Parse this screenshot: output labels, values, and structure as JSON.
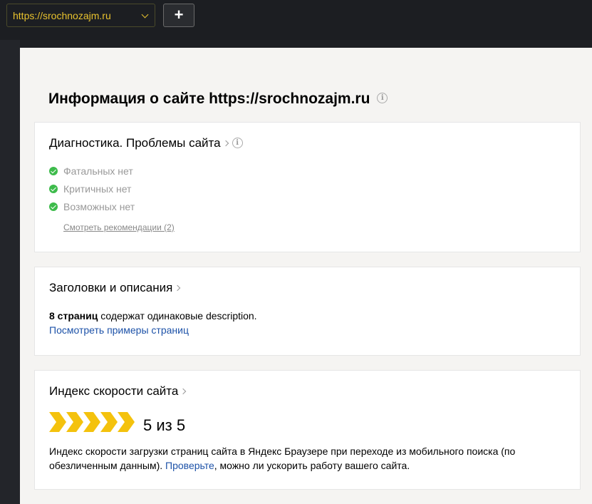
{
  "topbar": {
    "site_select_value": "https://srochnozajm.ru",
    "add_button_label": "+"
  },
  "page": {
    "title": "Информация о сайте https://srochnozajm.ru",
    "info_glyph": "i"
  },
  "diagnostics": {
    "title": "Диагностика. Проблемы сайта",
    "items": [
      {
        "label": "Фатальных нет",
        "status": "ok"
      },
      {
        "label": "Критичных нет",
        "status": "ok"
      },
      {
        "label": "Возможных нет",
        "status": "ok"
      }
    ],
    "recommendations_link": "Смотреть рекомендации (2)"
  },
  "headers": {
    "title": "Заголовки и описания",
    "pages_count": "8 страниц",
    "pages_text": " содержат одинаковые description.",
    "examples_link": "Посмотреть примеры страниц"
  },
  "speed": {
    "title": "Индекс скорости сайта",
    "score_value": 5,
    "score_max": 5,
    "score_text": "5 из 5",
    "desc_part1": "Индекс скорости загрузки страниц сайта в Яндекс Браузере при переходе из мобильного поиска (по обезличенным данным). ",
    "desc_link": "Проверьте",
    "desc_part2": ", можно ли ускорить работу вашего сайта."
  },
  "colors": {
    "accent_yellow": "#f4c20d",
    "select_text": "#e8c22e",
    "link_blue": "#1d52a8",
    "check_green": "#3dbb4b"
  },
  "icons": [
    "chevron-down-icon",
    "plus-icon",
    "info-icon",
    "chevron-right-icon",
    "check-circle-icon",
    "speed-chevron-icon"
  ]
}
